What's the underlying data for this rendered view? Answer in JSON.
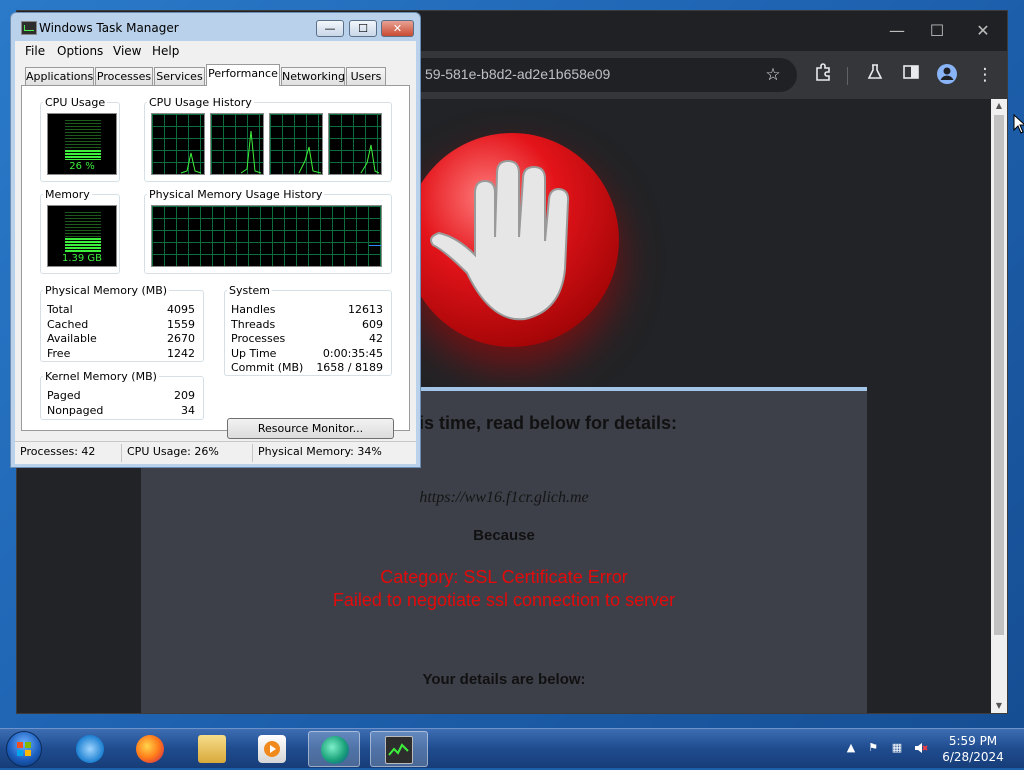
{
  "browser": {
    "url_text": "59-581e-b8d2-ad2e1b658e09",
    "window_controls": {
      "minimize": "—",
      "maximize": "☐",
      "close": "✕"
    },
    "page": {
      "heading": "ewed at this time, read below for details:",
      "blocked_url": "https://ww16.f1cr.glich.me",
      "because_label": "Because",
      "category": "Category: SSL Certificate Error",
      "reason": "Failed to negotiate ssl connection to server",
      "details_label": "Your details are below:"
    }
  },
  "task_manager": {
    "title": "Windows Task Manager",
    "menu": [
      "File",
      "Options",
      "View",
      "Help"
    ],
    "tabs": [
      "Applications",
      "Processes",
      "Services",
      "Performance",
      "Networking",
      "Users"
    ],
    "active_tab": "Performance",
    "cpu_usage_label": "CPU Usage",
    "cpu_usage_value": "26 %",
    "cpu_usage_percent": 26,
    "cpu_history_label": "CPU Usage History",
    "memory_label": "Memory",
    "memory_value": "1.39 GB",
    "memory_percent": 34,
    "phys_history_label": "Physical Memory Usage History",
    "physical_memory": {
      "label": "Physical Memory (MB)",
      "rows": [
        {
          "k": "Total",
          "v": "4095"
        },
        {
          "k": "Cached",
          "v": "1559"
        },
        {
          "k": "Available",
          "v": "2670"
        },
        {
          "k": "Free",
          "v": "1242"
        }
      ]
    },
    "system": {
      "label": "System",
      "rows": [
        {
          "k": "Handles",
          "v": "12613"
        },
        {
          "k": "Threads",
          "v": "609"
        },
        {
          "k": "Processes",
          "v": "42"
        },
        {
          "k": "Up Time",
          "v": "0:00:35:45"
        },
        {
          "k": "Commit (MB)",
          "v": "1658 / 8189"
        }
      ]
    },
    "kernel_memory": {
      "label": "Kernel Memory (MB)",
      "rows": [
        {
          "k": "Paged",
          "v": "209"
        },
        {
          "k": "Nonpaged",
          "v": "34"
        }
      ]
    },
    "resource_monitor_button": "Resource Monitor...",
    "status": {
      "processes": "Processes: 42",
      "cpu": "CPU Usage: 26%",
      "memory": "Physical Memory: 34%"
    }
  },
  "taskbar": {
    "apps": [
      "internet-explorer",
      "firefox",
      "file-explorer",
      "media-player",
      "edge",
      "task-manager"
    ],
    "time": "5:59 PM",
    "date": "6/28/2024"
  }
}
